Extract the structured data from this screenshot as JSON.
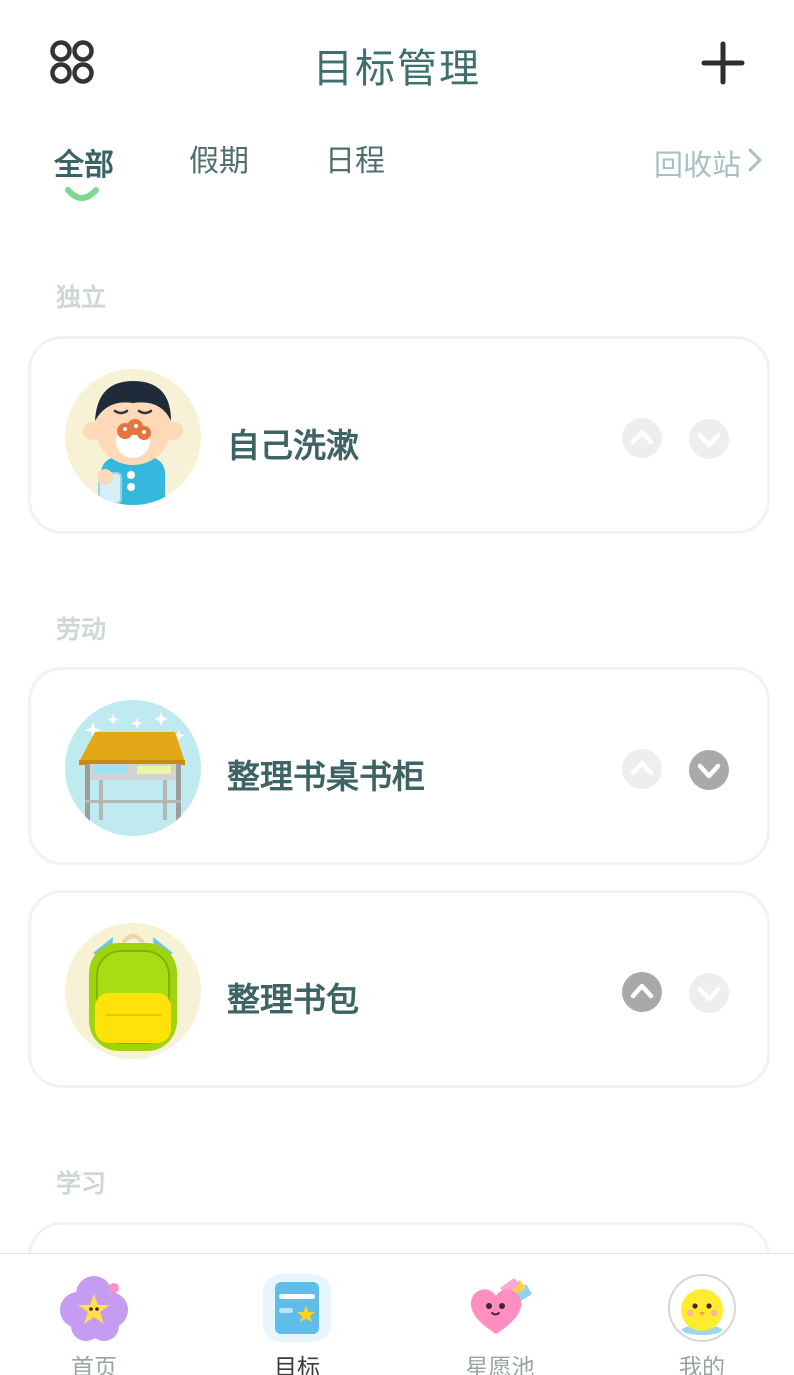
{
  "header": {
    "title": "目标管理",
    "menu_icon": "grid-menu-icon",
    "add_icon": "plus-icon"
  },
  "tabs": {
    "items": [
      "全部",
      "假期",
      "日程"
    ],
    "active_index": 0,
    "recycle_label": "回收站"
  },
  "sections": [
    {
      "label": "独立",
      "cards": [
        {
          "title": "自己洗漱",
          "icon": "brushing-teeth-boy-icon",
          "up_active": false,
          "down_active": false
        }
      ]
    },
    {
      "label": "劳动",
      "cards": [
        {
          "title": "整理书桌书柜",
          "icon": "desk-icon",
          "up_active": false,
          "down_active": true
        },
        {
          "title": "整理书包",
          "icon": "backpack-icon",
          "up_active": true,
          "down_active": false
        }
      ]
    },
    {
      "label": "学习",
      "cards": []
    }
  ],
  "bottom_nav": [
    {
      "label": "首页",
      "icon": "star-flower-icon",
      "active": false
    },
    {
      "label": "目标",
      "icon": "goal-card-icon",
      "active": true
    },
    {
      "label": "星愿池",
      "icon": "heart-wish-icon",
      "active": false
    },
    {
      "label": "我的",
      "icon": "chick-avatar-icon",
      "active": false
    }
  ],
  "colors": {
    "accent_green": "#7ed98c",
    "title_teal": "#3d6363",
    "arrow_active": "#a9a9a9",
    "arrow_inactive": "#eeeeee"
  }
}
